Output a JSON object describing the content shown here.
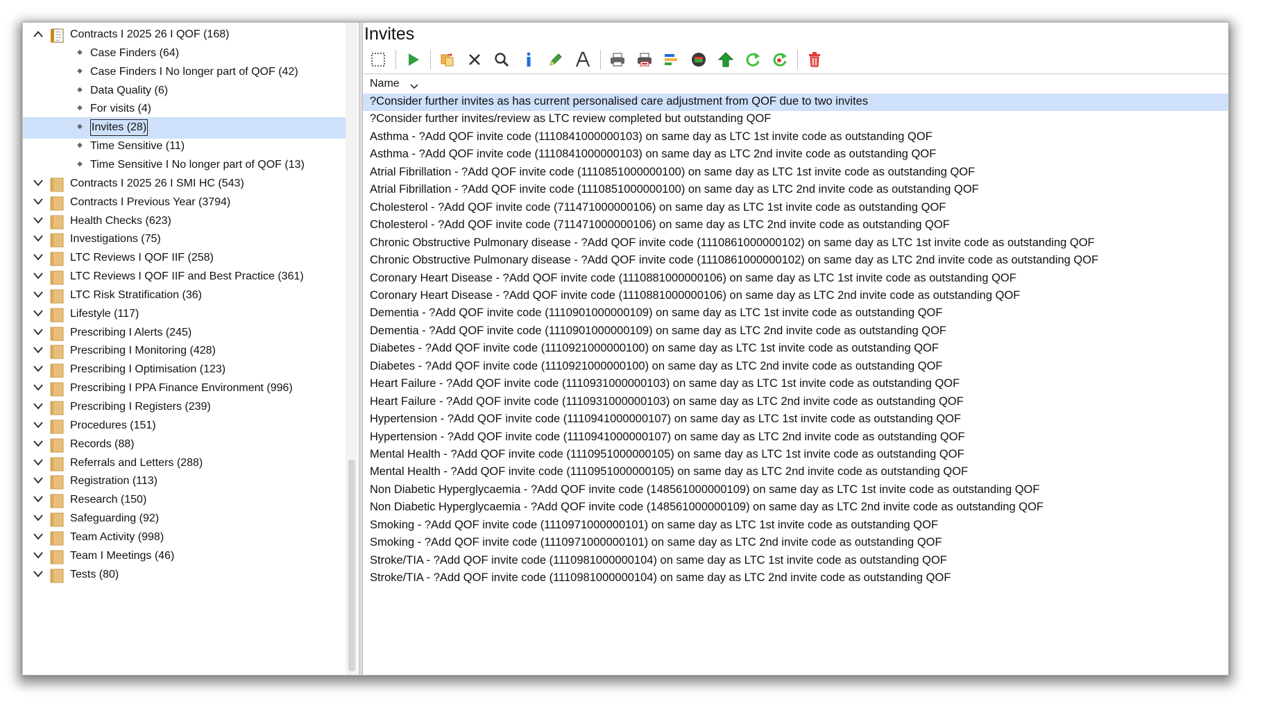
{
  "tree": {
    "expanded_folder": {
      "label": "Contracts I 2025 26 I QOF (168)"
    },
    "children": [
      {
        "label": "Case Finders (64)"
      },
      {
        "label": "Case Finders I No longer part of QOF (42)"
      },
      {
        "label": "Data Quality (6)"
      },
      {
        "label": "For visits (4)"
      },
      {
        "label": "Invites (28)",
        "selected": true
      },
      {
        "label": "Time Sensitive (11)"
      },
      {
        "label": "Time Sensitive I No longer part of QOF (13)"
      }
    ],
    "folders": [
      {
        "label": "Contracts I 2025 26 I SMI HC (543)"
      },
      {
        "label": "Contracts I Previous Year (3794)"
      },
      {
        "label": "Health Checks (623)"
      },
      {
        "label": "Investigations (75)"
      },
      {
        "label": "LTC Reviews I QOF IIF (258)"
      },
      {
        "label": "LTC Reviews I QOF IIF and Best Practice (361)"
      },
      {
        "label": "LTC Risk Stratification (36)"
      },
      {
        "label": "Lifestyle (117)"
      },
      {
        "label": "Prescribing I Alerts (245)"
      },
      {
        "label": "Prescribing I Monitoring (428)"
      },
      {
        "label": "Prescribing I Optimisation (123)"
      },
      {
        "label": "Prescribing I PPA Finance Environment (996)"
      },
      {
        "label": "Prescribing I Registers (239)"
      },
      {
        "label": "Procedures (151)"
      },
      {
        "label": "Records (88)"
      },
      {
        "label": "Referrals and Letters (288)"
      },
      {
        "label": "Registration (113)"
      },
      {
        "label": "Research (150)"
      },
      {
        "label": "Safeguarding (92)"
      },
      {
        "label": "Team Activity (998)"
      },
      {
        "label": "Team I Meetings (46)"
      },
      {
        "label": "Tests (80)"
      }
    ]
  },
  "panel": {
    "title": "Invites",
    "column_header": "Name"
  },
  "toolbar_icons": [
    "select-all-icon",
    "run-icon",
    "copy-move-icon",
    "delete-x-icon",
    "search-icon",
    "info-icon",
    "edit-pen-icon",
    "font-icon",
    "print-icon",
    "print-red-icon",
    "report-icon",
    "database-icon",
    "upload-arrow-icon",
    "refresh-icon",
    "refresh-red-icon",
    "trash-icon"
  ],
  "colors": {
    "selection": "#cfe0fa",
    "folder": "#e8bf7a",
    "run": "#2ea043",
    "delete": "#e53935"
  },
  "rows": [
    "?Consider further invites as has current personalised care adjustment from QOF due to two invites",
    "?Consider further invites/review as LTC review completed but outstanding QOF",
    "Asthma - ?Add QOF invite code (1110841000000103) on same day as LTC 1st invite code as outstanding QOF",
    "Asthma - ?Add QOF invite code (1110841000000103) on same day as LTC 2nd invite code as outstanding QOF",
    "Atrial Fibrillation - ?Add QOF invite code (1110851000000100) on same day as LTC 1st invite code as outstanding QOF",
    "Atrial Fibrillation - ?Add QOF invite code (1110851000000100) on same day as LTC 2nd invite code as outstanding QOF",
    "Cholesterol - ?Add QOF invite code (711471000000106) on same day as LTC 1st invite code as outstanding QOF",
    "Cholesterol - ?Add QOF invite code (711471000000106) on same day as LTC 2nd invite code as outstanding QOF",
    "Chronic Obstructive Pulmonary disease - ?Add QOF invite code (1110861000000102) on same day as LTC 1st invite code as outstanding QOF",
    "Chronic Obstructive Pulmonary disease - ?Add QOF invite code (1110861000000102) on same day as LTC 2nd invite code as outstanding QOF",
    "Coronary Heart Disease - ?Add QOF invite code (1110881000000106) on same day as LTC 1st invite code as outstanding QOF",
    "Coronary Heart Disease - ?Add QOF invite code (1110881000000106) on same day as LTC 2nd invite code as outstanding QOF",
    "Dementia - ?Add QOF invite code (1110901000000109) on same day as LTC 1st invite code as outstanding QOF",
    "Dementia - ?Add QOF invite code (1110901000000109) on same day as LTC 2nd invite code as outstanding QOF",
    "Diabetes - ?Add QOF invite code (1110921000000100) on same day as LTC 1st invite code as outstanding QOF",
    "Diabetes - ?Add QOF invite code (1110921000000100) on same day as LTC 2nd invite code as outstanding QOF",
    "Heart Failure - ?Add QOF invite code (1110931000000103) on same day as LTC 1st invite code as outstanding QOF",
    "Heart Failure - ?Add QOF invite code (1110931000000103) on same day as LTC 2nd invite code as outstanding QOF",
    "Hypertension - ?Add QOF invite code (1110941000000107) on same day as LTC 1st invite code as outstanding QOF",
    "Hypertension - ?Add QOF invite code (1110941000000107) on same day as LTC 2nd invite code as outstanding QOF",
    "Mental Health - ?Add QOF invite code (1110951000000105) on same day as LTC 1st invite code as outstanding QOF",
    "Mental Health - ?Add QOF invite code (1110951000000105) on same day as LTC 2nd invite code as outstanding QOF",
    "Non Diabetic Hyperglycaemia - ?Add QOF invite code (148561000000109) on same day as LTC 1st invite code as outstanding QOF",
    "Non Diabetic Hyperglycaemia - ?Add QOF invite code (148561000000109) on same day as LTC 2nd invite code as outstanding QOF",
    "Smoking - ?Add QOF invite code (1110971000000101) on same day as LTC 1st invite code as outstanding QOF",
    "Smoking - ?Add QOF invite code (1110971000000101) on same day as LTC 2nd invite code as outstanding QOF",
    "Stroke/TIA - ?Add QOF invite code (1110981000000104) on same day as LTC 1st invite code as outstanding QOF",
    "Stroke/TIA - ?Add QOF invite code (1110981000000104) on same day as LTC 2nd invite code as outstanding QOF"
  ]
}
